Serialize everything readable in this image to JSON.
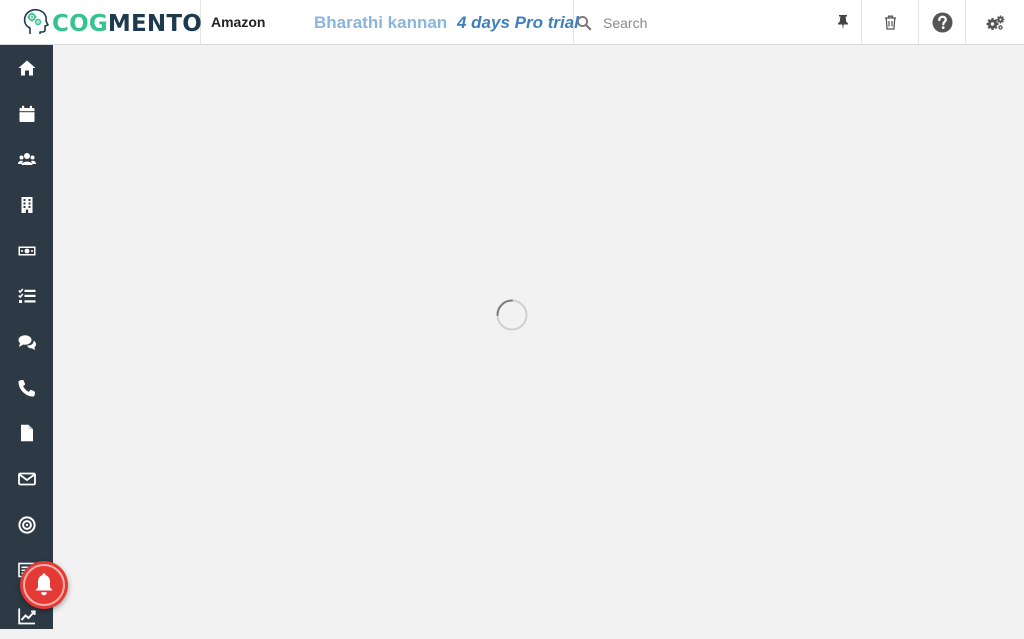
{
  "header": {
    "logo": {
      "part1": "COG",
      "part2": "MENTO"
    },
    "company": "Amazon",
    "user_name": "Bharathi kannan",
    "trial_text": "4 days Pro trial",
    "search": {
      "placeholder": "Search",
      "value": ""
    }
  },
  "colors": {
    "sidebar_bg": "#2d3a45",
    "brand_green": "#35c38e",
    "brand_navy": "#1e3a4e",
    "user_name": "#8ab6dd",
    "trial": "#3d7fc0",
    "notification": "#e53935"
  },
  "sidebar": {
    "items": [
      {
        "icon": "home-icon"
      },
      {
        "icon": "calendar-icon"
      },
      {
        "icon": "contacts-icon"
      },
      {
        "icon": "companies-icon"
      },
      {
        "icon": "deals-icon"
      },
      {
        "icon": "tasks-icon"
      },
      {
        "icon": "cases-icon"
      },
      {
        "icon": "calls-icon"
      },
      {
        "icon": "documents-icon"
      },
      {
        "icon": "email-icon"
      },
      {
        "icon": "campaigns-icon"
      },
      {
        "icon": "forms-icon"
      },
      {
        "icon": "reports-icon"
      }
    ]
  },
  "toolbar": {
    "icons": [
      "pin-icon",
      "trash-icon",
      "help-icon",
      "settings-icon"
    ]
  },
  "content": {
    "state": "loading"
  },
  "notification": {
    "icon": "bell-icon"
  }
}
